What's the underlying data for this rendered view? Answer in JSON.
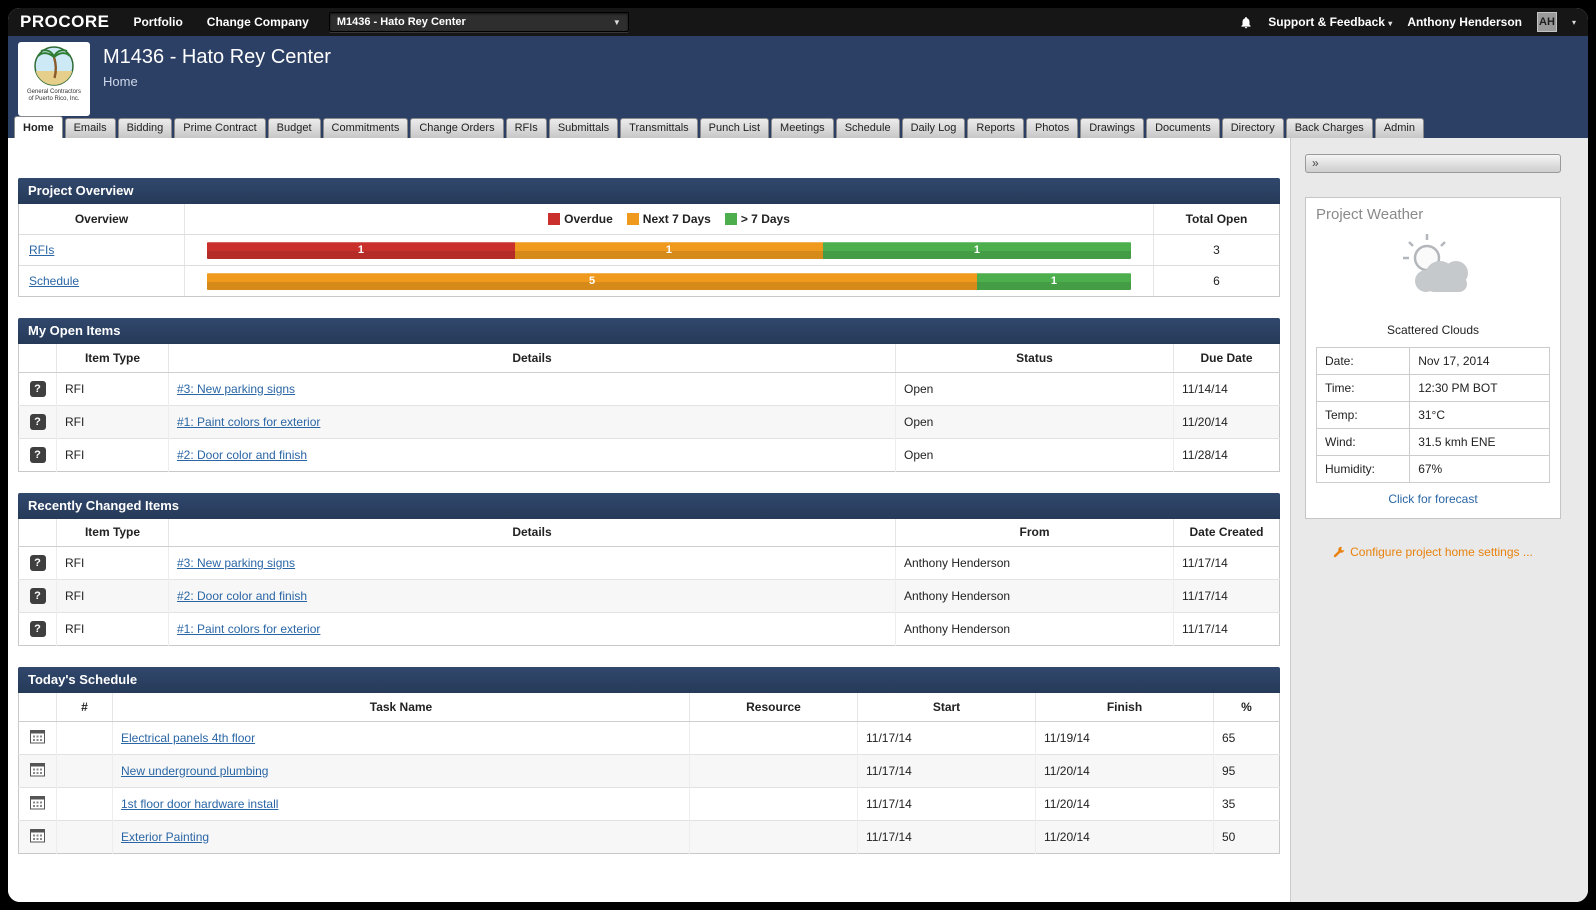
{
  "colors": {
    "navy": "#2c4065",
    "link_blue": "#2a66a5",
    "overdue_red": "#c9302c",
    "next7_orange": "#ef9a1d",
    "gt7_green": "#4cae4c",
    "configure_orange": "#e8820c"
  },
  "topbar": {
    "logo": "PROCORE",
    "portfolio": "Portfolio",
    "change_company": "Change Company",
    "project_select": "M1436 - Hato Rey Center",
    "support": "Support & Feedback",
    "user": "Anthony Henderson",
    "avatar": "AH"
  },
  "header": {
    "title": "M1436 - Hato Rey Center",
    "subtitle": "Home",
    "company_caption_line1": "General Contractors",
    "company_caption_line2": "of Puerto Rico, Inc."
  },
  "tabs": [
    "Home",
    "Emails",
    "Bidding",
    "Prime Contract",
    "Budget",
    "Commitments",
    "Change Orders",
    "RFIs",
    "Submittals",
    "Transmittals",
    "Punch List",
    "Meetings",
    "Schedule",
    "Daily Log",
    "Reports",
    "Photos",
    "Drawings",
    "Documents",
    "Directory",
    "Back Charges",
    "Admin"
  ],
  "active_tab": 0,
  "project_overview": {
    "title": "Project Overview",
    "col_overview": "Overview",
    "col_total": "Total Open",
    "legend": [
      {
        "label": "Overdue",
        "color": "#c9302c"
      },
      {
        "label": "Next 7 Days",
        "color": "#ef9a1d"
      },
      {
        "label": "> 7 Days",
        "color": "#4cae4c"
      }
    ],
    "rows": [
      {
        "label": "RFIs",
        "total": "3",
        "segments": [
          {
            "value": 1,
            "color": "#c9302c"
          },
          {
            "value": 1,
            "color": "#ef9a1d"
          },
          {
            "value": 1,
            "color": "#4cae4c"
          }
        ]
      },
      {
        "label": "Schedule",
        "total": "6",
        "segments": [
          {
            "value": 5,
            "color": "#ef9a1d"
          },
          {
            "value": 1,
            "color": "#4cae4c"
          }
        ]
      }
    ]
  },
  "my_open_items": {
    "title": "My Open Items",
    "columns": [
      "Item Type",
      "Details",
      "Status",
      "Due Date"
    ],
    "rows": [
      {
        "type": "RFI",
        "details": "#3: New parking signs",
        "status": "Open",
        "due_date": "11/14/14"
      },
      {
        "type": "RFI",
        "details": "#1: Paint colors for exterior",
        "status": "Open",
        "due_date": "11/20/14"
      },
      {
        "type": "RFI",
        "details": "#2: Door color and finish",
        "status": "Open",
        "due_date": "11/28/14"
      }
    ]
  },
  "recently_changed_items": {
    "title": "Recently Changed Items",
    "columns": [
      "Item Type",
      "Details",
      "From",
      "Date Created"
    ],
    "rows": [
      {
        "type": "RFI",
        "details": "#3: New parking signs",
        "from": "Anthony Henderson",
        "date_created": "11/17/14"
      },
      {
        "type": "RFI",
        "details": "#2: Door color and finish",
        "from": "Anthony Henderson",
        "date_created": "11/17/14"
      },
      {
        "type": "RFI",
        "details": "#1: Paint colors for exterior",
        "from": "Anthony Henderson",
        "date_created": "11/17/14"
      }
    ]
  },
  "todays_schedule": {
    "title": "Today's Schedule",
    "columns": [
      "#",
      "Task Name",
      "Resource",
      "Start",
      "Finish",
      "%"
    ],
    "rows": [
      {
        "num": "",
        "task": "Electrical panels 4th floor",
        "resource": "",
        "start": "11/17/14",
        "finish": "11/19/14",
        "pct": "65"
      },
      {
        "num": "",
        "task": "New underground plumbing",
        "resource": "",
        "start": "11/17/14",
        "finish": "11/20/14",
        "pct": "95"
      },
      {
        "num": "",
        "task": "1st floor door hardware install",
        "resource": "",
        "start": "11/17/14",
        "finish": "11/20/14",
        "pct": "35"
      },
      {
        "num": "",
        "task": "Exterior Painting",
        "resource": "",
        "start": "11/17/14",
        "finish": "11/20/14",
        "pct": "50"
      }
    ]
  },
  "sidebar": {
    "collapse": "»",
    "weather": {
      "title": "Project Weather",
      "condition": "Scattered Clouds",
      "rows": [
        [
          "Date:",
          "Nov 17, 2014"
        ],
        [
          "Time:",
          "12:30 PM BOT"
        ],
        [
          "Temp:",
          "31°C"
        ],
        [
          "Wind:",
          "31.5 kmh ENE"
        ],
        [
          "Humidity:",
          "67%"
        ]
      ],
      "forecast_link": "Click for forecast"
    },
    "configure_link": "Configure project home settings ..."
  }
}
